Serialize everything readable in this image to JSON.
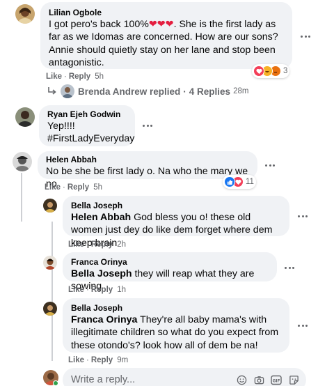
{
  "comments": [
    {
      "author": "Lilian Ogbole",
      "text_before": "I got pero's back 100%",
      "text_after": ". She is the first lady as far as we Idomas are concerned. How are our sons? Annie should quietly stay on her lane and stop been antagonistic.",
      "like": "Like",
      "reply": "Reply",
      "time": "5h",
      "reaction_count": "3",
      "replied_by": "Brenda Andrew replied",
      "replies_count": "4 Replies",
      "replies_time": "28m"
    },
    {
      "author": "Ryan Ejeh Godwin",
      "line1": "Yep!!!!",
      "line2": "#FirstLadyEveryday"
    },
    {
      "author": "Helen Abbah",
      "text": "No be she be first lady o. Na who the mary we no",
      "like": "Like",
      "reply": "Reply",
      "time": "5h",
      "reaction_count": "11"
    }
  ],
  "replies": [
    {
      "author": "Bella Joseph",
      "mention": "Helen Abbah",
      "text": " God bless you o! these old women just dey do like dem forget where dem keep brain",
      "like": "Like",
      "reply": "Reply",
      "time": "2h"
    },
    {
      "author": "Franca Orinya",
      "mention": "Bella Joseph",
      "text": " they will reap what they are sowing",
      "like": "Like",
      "reply": "Reply",
      "time": "1h"
    },
    {
      "author": "Bella Joseph",
      "mention": "Franca Orinya",
      "text": " They're all baby mama's with illegitimate children so what do you expect from these otondo's? look how all of dem be na!",
      "like": "Like",
      "reply": "Reply",
      "time": "9m"
    }
  ],
  "reply_box": {
    "placeholder": "Write a reply..."
  },
  "icons": {
    "heart": "heart-icon",
    "haha": "haha-icon",
    "angry": "angry-icon",
    "like": "like-icon",
    "emoji": "emoji-icon",
    "camera": "camera-icon",
    "gif": "gif-icon",
    "sticker": "sticker-icon",
    "more": "more-options-icon",
    "reply_arrow": "reply-arrow-icon"
  },
  "colors": {
    "bubble": "#f0f2f5",
    "secondary_text": "#65676b",
    "like_blue": "#1877f2",
    "heart_red": "#f33e58",
    "online_green": "#31a24c"
  }
}
